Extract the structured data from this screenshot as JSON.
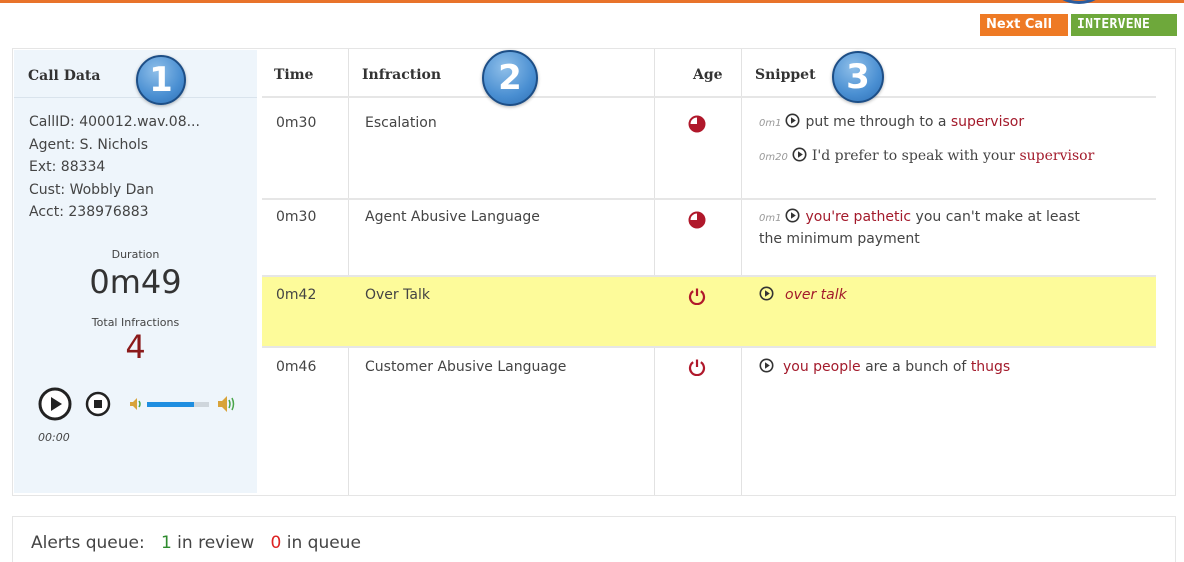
{
  "header": {
    "next_call_label": "Next Call",
    "intervene_label": "INTERVENE"
  },
  "call_data": {
    "title": "Call Data",
    "call_id": "CallID: 400012.wav.08...",
    "agent": "Agent: S. Nichols",
    "ext": "Ext: 88334",
    "cust": "Cust: Wobbly Dan",
    "acct": "Acct: 238976883",
    "duration_label": "Duration",
    "duration": "0m49",
    "total_infractions_label": "Total Infractions",
    "total_infractions": "4",
    "timecode": "00:00",
    "volume_level": 0.75
  },
  "columns": {
    "time": "Time",
    "infraction": "Infraction",
    "age": "Age",
    "snippet": "Snippet"
  },
  "rows": [
    {
      "time": "0m30",
      "infraction": "Escalation",
      "age_icon": "pie-three-quarter-icon",
      "snippets": [
        {
          "ts": "0m1",
          "pre": "put me through to a ",
          "hl": "supervisor",
          "post": ""
        },
        {
          "ts": "0m20",
          "pre": "I'd prefer to speak with your ",
          "hl": "supervisor",
          "post": ""
        }
      ]
    },
    {
      "time": "0m30",
      "infraction": "Agent Abusive Language",
      "age_icon": "pie-three-quarter-icon",
      "snippet": {
        "ts": "0m1",
        "hl": "you're pathetic",
        "post": " you can't make at least",
        "line2": "the minimum payment"
      }
    },
    {
      "time": "0m42",
      "infraction": "Over Talk",
      "age_icon": "power-icon",
      "snippet": {
        "text": "over talk"
      }
    },
    {
      "time": "0m46",
      "infraction": "Customer Abusive Language",
      "age_icon": "power-icon",
      "snippet": {
        "hl1": "you people",
        "mid": " are a bunch of ",
        "hl2": "thugs"
      }
    }
  ],
  "badges": [
    "1",
    "2",
    "3"
  ],
  "alerts": {
    "label": "Alerts queue:",
    "review_count": "1",
    "review_label": "in review",
    "queue_count": "0",
    "queue_label": "in queue"
  },
  "colors": {
    "accent_orange": "#ee7a25",
    "intervene_green": "#6ea83b",
    "highlight_yellow": "#fdfb9a",
    "infraction_red": "#a31a2b",
    "badge_blue": "#4a8fd2"
  }
}
